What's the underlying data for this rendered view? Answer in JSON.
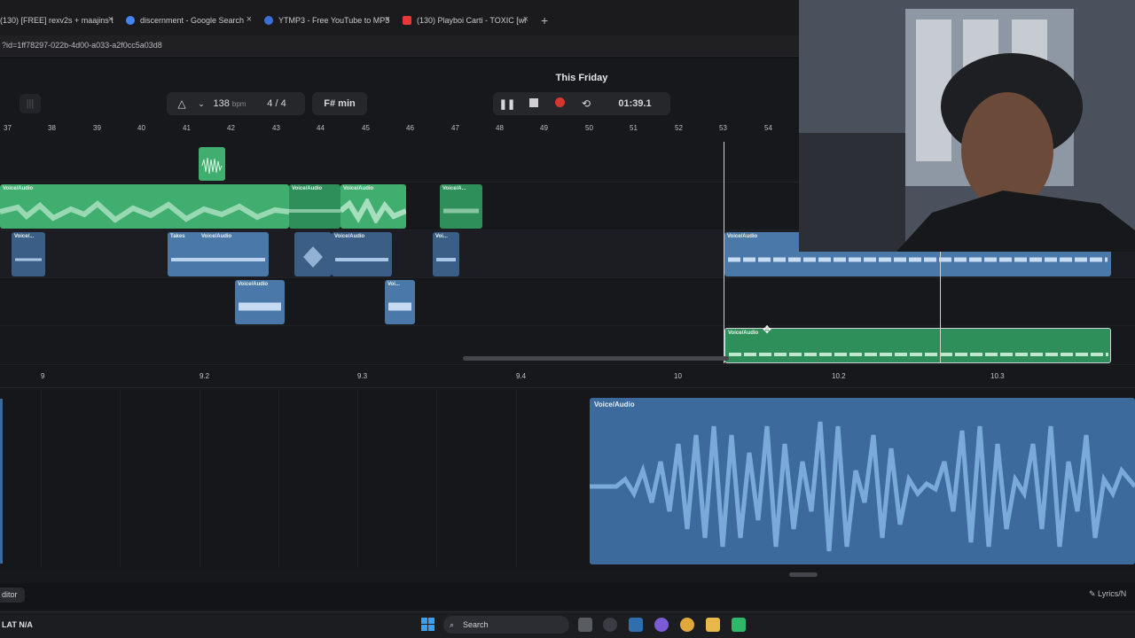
{
  "browser": {
    "tabs": [
      {
        "title": "(130) [FREE] rexv2s + maajins t",
        "icon_color": "#e53935"
      },
      {
        "title": "discernment - Google Search",
        "icon_color": "#4285f4"
      },
      {
        "title": "YTMP3 - Free YouTube to MP3",
        "icon_color": "#3b6fd6"
      },
      {
        "title": "(130) Playboi Carti - TOXIC [wi",
        "icon_color": "#e53935"
      }
    ],
    "new_tab": "+",
    "close_glyph": "×",
    "address": "?id=1ff78297-022b-4d00-a033-a2f0cc5a03d8"
  },
  "project": {
    "title": "This Friday"
  },
  "toolbar": {
    "tempo": "138",
    "tempo_unit": "bpm",
    "time_signature": "4 / 4",
    "key": "F# min",
    "position": "01:39.1",
    "metronome_icon": "metronome-icon",
    "dropdown_icon": "chevron-down-icon"
  },
  "timeline": {
    "bars": [
      "37",
      "38",
      "39",
      "40",
      "41",
      "42",
      "43",
      "44",
      "45",
      "46",
      "47",
      "48",
      "49",
      "50",
      "51",
      "52",
      "53",
      "54"
    ],
    "zoom_ticks": [
      "9",
      "9.2",
      "9.3",
      "9.4",
      "10",
      "10.2",
      "10.3"
    ]
  },
  "clips": {
    "voice_audio": "Voice/Audio",
    "voice_short": "Voice/...",
    "voice_short2": "Voice/A...",
    "voi": "Voi...",
    "takes": "Takes"
  },
  "editor": {
    "clip_label": "Voice/Audio",
    "tab_label": "ditor",
    "lyrics_label": "Lyrics/N"
  },
  "statusbar": {
    "left": "LAT  N/A"
  },
  "taskbar": {
    "search_label": "Search"
  },
  "colors": {
    "green_clip": "#2f8f5a",
    "blue_clip": "#3a5e86",
    "record": "#d8352f",
    "accent": "#4a78a8"
  }
}
